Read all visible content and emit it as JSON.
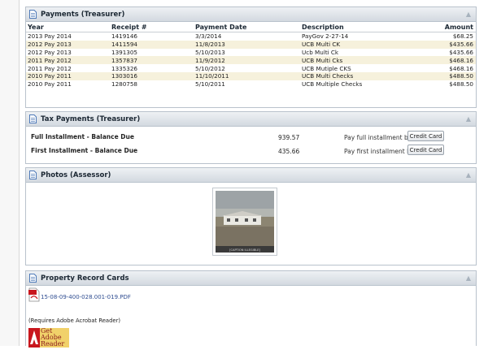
{
  "payments_panel": {
    "title": "Payments (Treasurer)",
    "columns": [
      "Year",
      "Receipt #",
      "Payment Date",
      "Description",
      "Amount"
    ],
    "rows": [
      {
        "year": "2013 Pay 2014",
        "receipt": "1419146",
        "date": "3/3/2014",
        "description": "PayGov 2-27-14",
        "amount": "$68.25"
      },
      {
        "year": "2012 Pay 2013",
        "receipt": "1411594",
        "date": "11/8/2013",
        "description": "UCB Multi CK",
        "amount": "$435.66"
      },
      {
        "year": "2012 Pay 2013",
        "receipt": "1391305",
        "date": "5/10/2013",
        "description": "Ucb Multi Ck",
        "amount": "$435.66"
      },
      {
        "year": "2011 Pay 2012",
        "receipt": "1357837",
        "date": "11/9/2012",
        "description": "UCB Multi Cks",
        "amount": "$468.16"
      },
      {
        "year": "2011 Pay 2012",
        "receipt": "1335326",
        "date": "5/10/2012",
        "description": "UCB Mutiple CKS",
        "amount": "$468.16"
      },
      {
        "year": "2010 Pay 2011",
        "receipt": "1303016",
        "date": "11/10/2011",
        "description": "UCB Multi Checks",
        "amount": "$488.50"
      },
      {
        "year": "2010 Pay 2011",
        "receipt": "1280758",
        "date": "5/10/2011",
        "description": "UCB Multiple Checks",
        "amount": "$488.50"
      }
    ]
  },
  "tax_panel": {
    "title": "Tax Payments (Treasurer)",
    "rows": [
      {
        "label": "Full Installment - Balance Due",
        "amount": "939.57",
        "pay_label": "Pay full installment by:",
        "button": "Credit Card"
      },
      {
        "label": "First Installment - Balance Due",
        "amount": "435.66",
        "pay_label": "Pay first installment by:",
        "button": "Credit Card"
      }
    ]
  },
  "photos_panel": {
    "title": "Photos (Assessor)",
    "photo_caption": "[CAPTION ILLEGIBLE]"
  },
  "property_panel": {
    "title": "Property Record Cards",
    "pdf_link": "15-08-09-400-028.001-019.PDF",
    "requires_text": "(Requires Adobe Acrobat Reader)",
    "reader_badge_text": "Get Adobe Reader"
  },
  "colors": {
    "header_bg": "#d3d9e0",
    "row_alt_bg": "#f6f1dc",
    "link": "#2f4d91",
    "panel_border": "#b9c2cc"
  },
  "icons": {
    "panel": "document-icon",
    "collapse": "collapse-arrow-icon",
    "pdf": "pdf-file-icon",
    "reader": "adobe-reader-icon"
  }
}
